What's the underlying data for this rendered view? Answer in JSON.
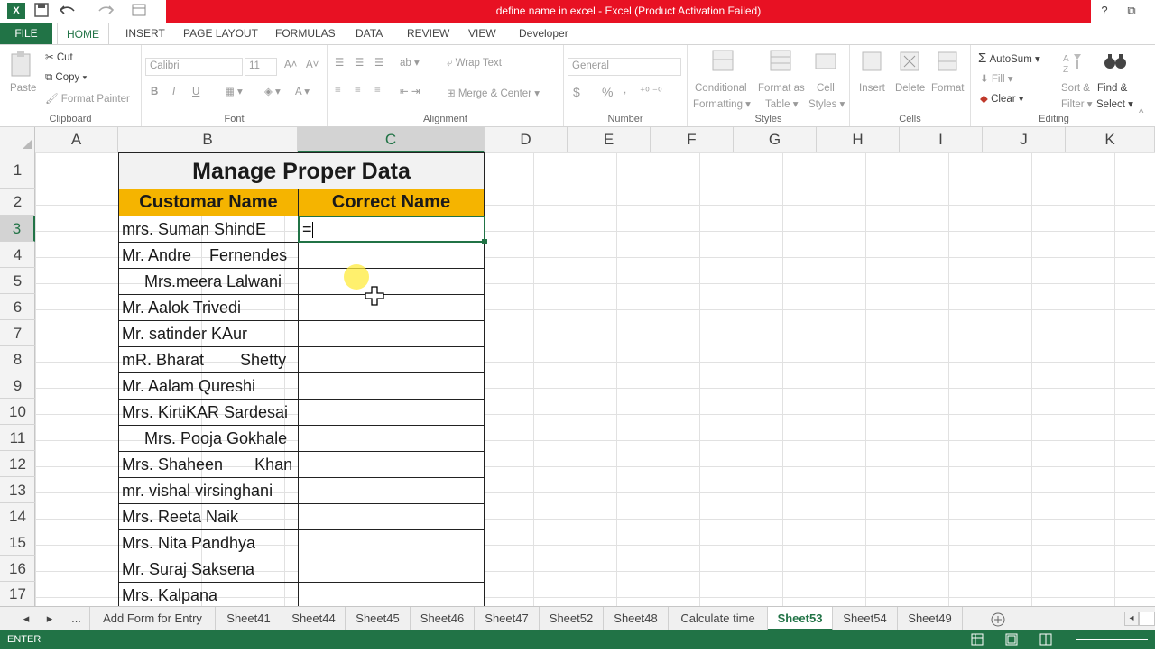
{
  "window": {
    "title": "define name in excel -  Excel (Product Activation Failed)",
    "help": "?",
    "restore": "⧉"
  },
  "qat": {
    "app_icon": "X",
    "save_icon": "save-icon",
    "undo_icon": "undo-icon",
    "redo_icon": "redo-icon"
  },
  "tabs": [
    "FILE",
    "HOME",
    "INSERT",
    "PAGE LAYOUT",
    "FORMULAS",
    "DATA",
    "REVIEW",
    "VIEW",
    "Developer"
  ],
  "ribbon": {
    "clipboard": {
      "paste": "Paste",
      "cut": "Cut",
      "copy": "Copy",
      "format_painter": "Format Painter",
      "label": "Clipboard"
    },
    "font": {
      "name": "Calibri",
      "size": "11",
      "bold": "B",
      "italic": "I",
      "underline": "U",
      "label": "Font"
    },
    "alignment": {
      "wrap": "Wrap Text",
      "merge": "Merge & Center",
      "label": "Alignment"
    },
    "number": {
      "format": "General",
      "currency": "$",
      "percent": "%",
      "label": "Number"
    },
    "styles": {
      "conditional": "Conditional",
      "conditional2": "Formatting",
      "format_as": "Format as",
      "table": "Table",
      "cell": "Cell",
      "cell_styles": "Styles",
      "label": "Styles"
    },
    "cells": {
      "insert": "Insert",
      "delete": "Delete",
      "format": "Format",
      "label": "Cells"
    },
    "editing": {
      "autosum": "AutoSum",
      "fill": "Fill",
      "clear": "Clear",
      "sort": "Sort &",
      "filter": "Filter",
      "find": "Find &",
      "select": "Select",
      "label": "Editing"
    }
  },
  "columns": [
    "A",
    "B",
    "C",
    "D",
    "E",
    "F",
    "G",
    "H",
    "I",
    "J",
    "K"
  ],
  "rows": [
    "1",
    "2",
    "3",
    "4",
    "5",
    "6",
    "7",
    "8",
    "9",
    "10",
    "11",
    "12",
    "13",
    "14",
    "15",
    "16",
    "17"
  ],
  "sheet": {
    "title": "Manage Proper Data",
    "header_b": "Customar Name",
    "header_c": "Correct Name",
    "editing_value": "=",
    "names": [
      "mrs. Suman ShindE",
      "Mr. Andre    Fernendes",
      "     Mrs.meera Lalwani",
      "Mr. Aalok Trivedi",
      "Mr. satinder KAur",
      "mR. Bharat        Shetty",
      "Mr. Aalam Qureshi",
      "Mrs. KirtiKAR Sardesai",
      "     Mrs. Pooja Gokhale",
      "Mrs. Shaheen       Khan",
      "mr. vishal virsinghani",
      "Mrs. Reeta Naik",
      "Mrs. Nita Pandhya",
      "Mr. Suraj Saksena",
      "Mrs. Kalpana"
    ],
    "header_color": "#f5b400",
    "title_bg": "#f2f2f2"
  },
  "sheet_tabs": [
    "...",
    "Add Form for Entry",
    "Sheet41",
    "Sheet44",
    "Sheet45",
    "Sheet46",
    "Sheet47",
    "Sheet52",
    "Sheet48",
    "Calculate time",
    "Sheet53",
    "Sheet54",
    "Sheet49"
  ],
  "active_sheet": "Sheet53",
  "status": {
    "mode": "ENTER"
  },
  "colors": {
    "accent": "#217346",
    "title_red": "#e81123"
  }
}
